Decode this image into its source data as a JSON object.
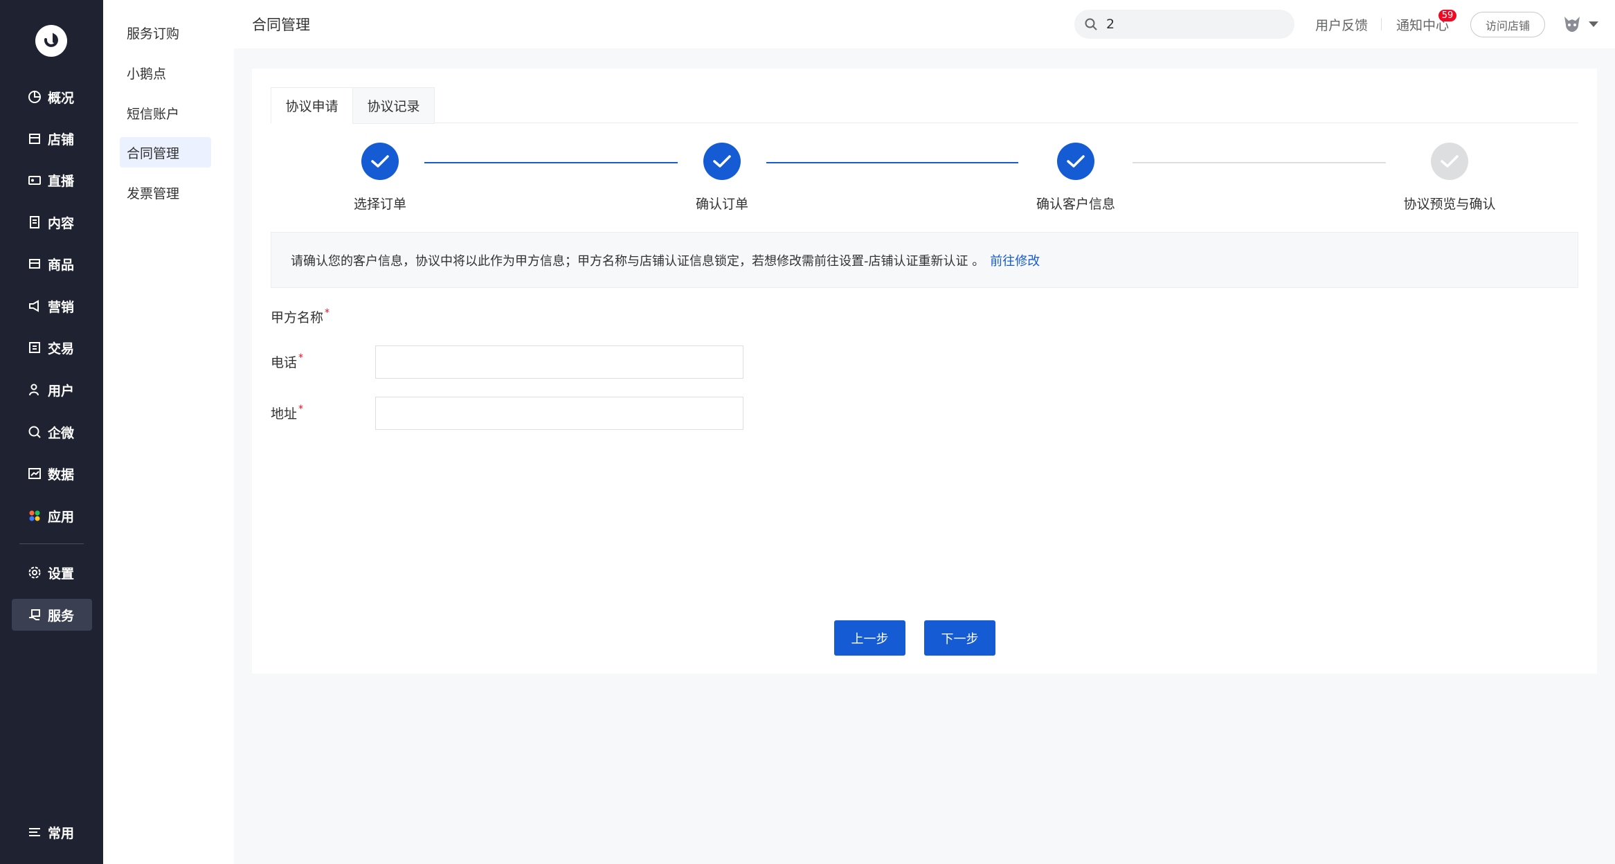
{
  "nav": {
    "items": [
      {
        "label": "概况",
        "icon": "pie-chart-icon"
      },
      {
        "label": "店铺",
        "icon": "store-icon"
      },
      {
        "label": "直播",
        "icon": "live-icon"
      },
      {
        "label": "内容",
        "icon": "document-icon"
      },
      {
        "label": "商品",
        "icon": "box-icon"
      },
      {
        "label": "营销",
        "icon": "megaphone-icon"
      },
      {
        "label": "交易",
        "icon": "trade-icon"
      },
      {
        "label": "用户",
        "icon": "user-icon"
      },
      {
        "label": "企微",
        "icon": "chat-icon"
      },
      {
        "label": "数据",
        "icon": "data-icon"
      },
      {
        "label": "应用",
        "icon": "apps-icon"
      },
      {
        "label": "设置",
        "icon": "gear-icon"
      },
      {
        "label": "服务",
        "icon": "service-icon"
      }
    ],
    "bottom_label": "常用"
  },
  "subnav": {
    "items": [
      "服务订购",
      "小鹅点",
      "短信账户",
      "合同管理",
      "发票管理"
    ],
    "active": "合同管理"
  },
  "topbar": {
    "title": "合同管理",
    "search_value": "2",
    "feedback": "用户反馈",
    "notifications": "通知中心",
    "notification_count": "59",
    "visit_store": "访问店铺"
  },
  "tabs": [
    "协议申请",
    "协议记录"
  ],
  "steps": [
    {
      "label": "选择订单",
      "status": "done"
    },
    {
      "label": "确认订单",
      "status": "done"
    },
    {
      "label": "确认客户信息",
      "status": "done"
    },
    {
      "label": "协议预览与确认",
      "status": "todo"
    }
  ],
  "notice": {
    "text": "请确认您的客户信息，协议中将以此作为甲方信息；甲方名称与店铺认证信息锁定，若想修改需前往设置-店铺认证重新认证 。",
    "link": "前往修改"
  },
  "form": {
    "party_a_label": "甲方名称",
    "party_a_value": "",
    "phone_label": "电话",
    "phone_value": "",
    "address_label": "地址",
    "address_value": "",
    "required_mark": "*"
  },
  "buttons": {
    "prev": "上一步",
    "next": "下一步"
  },
  "colors": {
    "primary": "#155bd4",
    "sidebar_bg": "#1f2230",
    "badge": "#ee0a24"
  }
}
